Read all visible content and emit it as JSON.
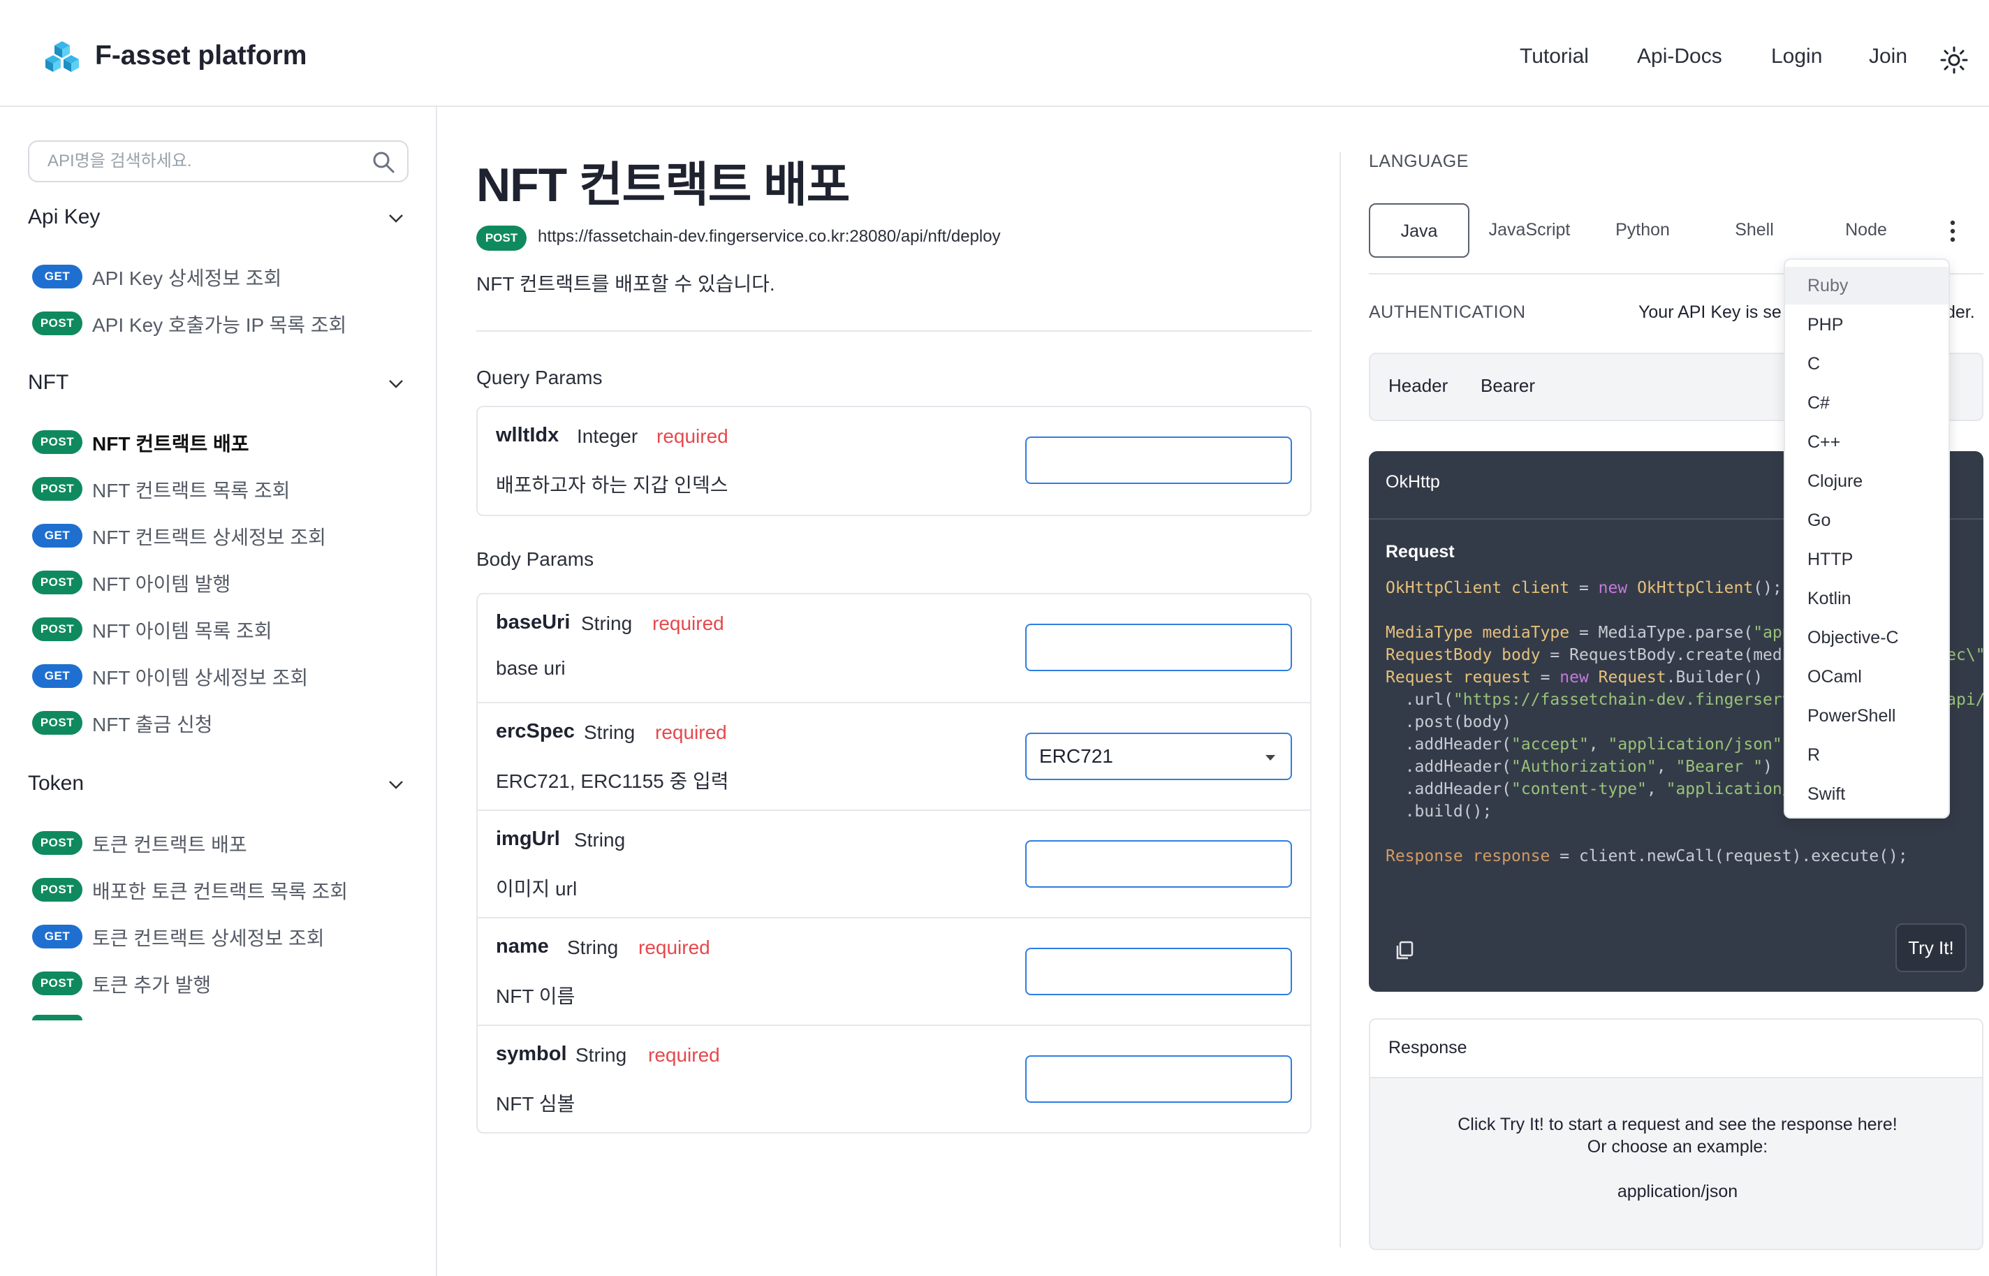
{
  "header": {
    "app_title": "F-asset platform",
    "nav": [
      "Tutorial",
      "Api-Docs",
      "Login",
      "Join"
    ]
  },
  "sidebar": {
    "search_placeholder": "API명을 검색하세요.",
    "groups": [
      {
        "title": "Api Key",
        "items": [
          {
            "method": "GET",
            "label": "API Key 상세정보 조회"
          },
          {
            "method": "POST",
            "label": "API Key 호출가능 IP 목록 조회"
          }
        ]
      },
      {
        "title": "NFT",
        "items": [
          {
            "method": "POST",
            "label": "NFT 컨트랙트 배포",
            "active": true
          },
          {
            "method": "POST",
            "label": "NFT 컨트랙트 목록 조회"
          },
          {
            "method": "GET",
            "label": "NFT 컨트랙트 상세정보 조회"
          },
          {
            "method": "POST",
            "label": "NFT 아이템 발행"
          },
          {
            "method": "POST",
            "label": "NFT 아이템 목록 조회"
          },
          {
            "method": "GET",
            "label": "NFT 아이템 상세정보 조회"
          },
          {
            "method": "POST",
            "label": "NFT 출금 신청"
          }
        ]
      },
      {
        "title": "Token",
        "items": [
          {
            "method": "POST",
            "label": "토큰 컨트랙트 배포"
          },
          {
            "method": "POST",
            "label": "배포한 토큰 컨트랙트 목록 조회"
          },
          {
            "method": "GET",
            "label": "토큰 컨트랙트 상세정보 조회"
          },
          {
            "method": "POST",
            "label": "토큰 추가 발행"
          }
        ]
      }
    ]
  },
  "main": {
    "title": "NFT 컨트랙트 배포",
    "method": "POST",
    "url": "https://fassetchain-dev.fingerservice.co.kr:28080/api/nft/deploy",
    "description": "NFT 컨트랙트를 배포할 수 있습니다.",
    "query_title": "Query Params",
    "body_title": "Body Params",
    "required_label": "required",
    "query_params": [
      {
        "name": "wlltIdx",
        "type": "Integer",
        "required": true,
        "desc": "배포하고자 하는 지갑 인덱스"
      }
    ],
    "body_params": [
      {
        "name": "baseUri",
        "type": "String",
        "required": true,
        "desc": "base uri"
      },
      {
        "name": "ercSpec",
        "type": "String",
        "required": true,
        "desc": "ERC721, ERC1155 중 입력",
        "select_value": "ERC721"
      },
      {
        "name": "imgUrl",
        "type": "String",
        "required": false,
        "desc": "이미지 url"
      },
      {
        "name": "name",
        "type": "String",
        "required": true,
        "desc": "NFT 이름"
      },
      {
        "name": "symbol",
        "type": "String",
        "required": true,
        "desc": "NFT 심볼"
      }
    ]
  },
  "right": {
    "language_label": "LANGUAGE",
    "languages": [
      "Java",
      "JavaScript",
      "Python",
      "Shell",
      "Node"
    ],
    "selected_language": "Java",
    "auth_label": "AUTHENTICATION",
    "auth_note": "Your API Key is se",
    "auth_note_tail": "der.",
    "auth_header_key": "Header",
    "auth_header_val": "Bearer",
    "code_title": "OkHttp",
    "code_subtitle": "Request",
    "try_label": "Try It!",
    "response_title": "Response",
    "response_msg1": "Click Try It! to start a request and see the response here!",
    "response_msg2": "Or choose an example:",
    "response_example": "application/json"
  },
  "more_languages": [
    "Ruby",
    "PHP",
    "C",
    "C#",
    "C++",
    "Clojure",
    "Go",
    "HTTP",
    "Kotlin",
    "Objective-C",
    "OCaml",
    "PowerShell",
    "R",
    "Swift"
  ],
  "highlighted_language": "Ruby",
  "colors": {
    "get_badge": "#1f6fd0",
    "post_badge": "#0f8a5f",
    "required": "#e5484d",
    "input_border": "#2f7de1",
    "code_bg": "#343b48"
  }
}
